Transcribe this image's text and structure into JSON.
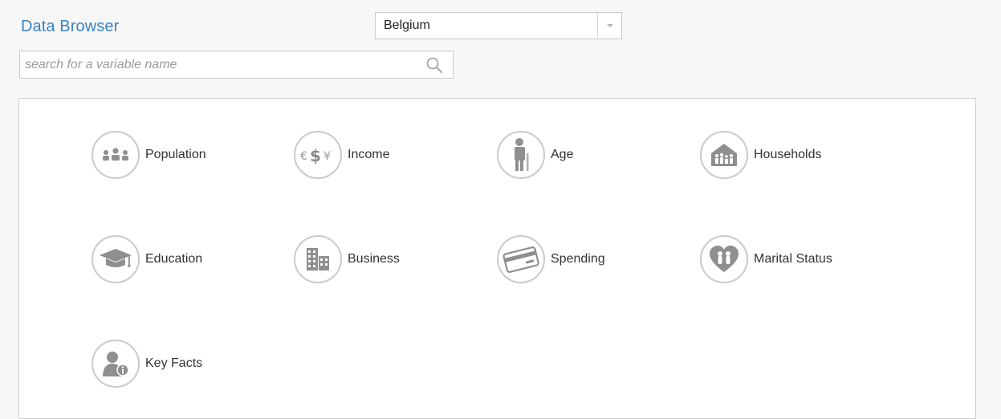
{
  "header": {
    "title": "Data Browser"
  },
  "country_select": {
    "selected": "Belgium"
  },
  "search": {
    "placeholder": "search for a variable name",
    "value": ""
  },
  "categories": [
    {
      "label": "Population",
      "icon": "population-icon"
    },
    {
      "label": "Income",
      "icon": "currency-icon"
    },
    {
      "label": "Age",
      "icon": "age-icon"
    },
    {
      "label": "Households",
      "icon": "households-icon"
    },
    {
      "label": "Education",
      "icon": "graduation-cap-icon"
    },
    {
      "label": "Business",
      "icon": "buildings-icon"
    },
    {
      "label": "Spending",
      "icon": "credit-card-icon"
    },
    {
      "label": "Marital Status",
      "icon": "heart-icon"
    },
    {
      "label": "Key Facts",
      "icon": "key-facts-icon"
    }
  ],
  "colors": {
    "title": "#3a83bd",
    "icon": "#8f8f8f",
    "icon_border": "#cacaca"
  }
}
